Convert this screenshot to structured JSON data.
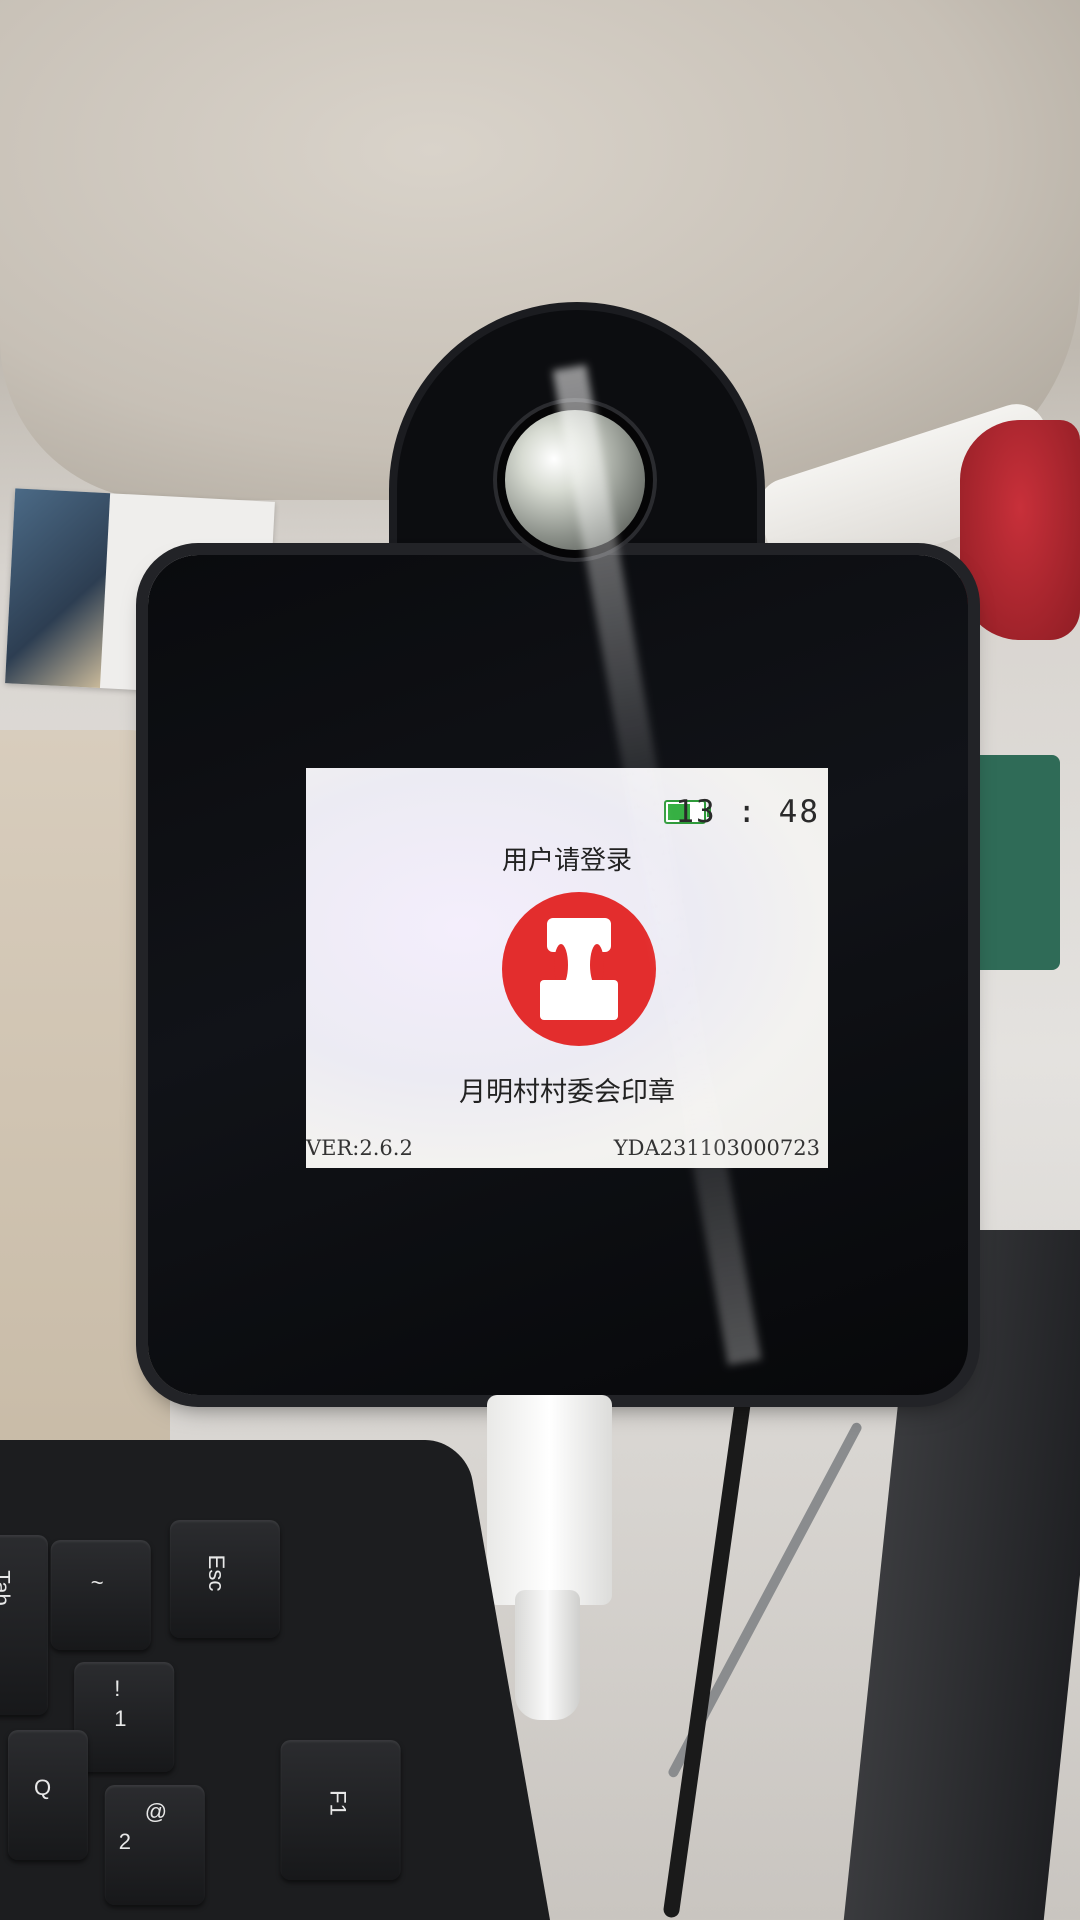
{
  "device_screen": {
    "time": "13 : 48",
    "battery_icon": "battery-full-icon",
    "login_prompt": "用户请登录",
    "seal_icon": "stamp-icon",
    "seal_name": "月明村村委会印章",
    "version": "VER:2.6.2",
    "serial": "YDA231103000723",
    "accent_color": "#e32d2d",
    "battery_color": "#36b043"
  },
  "keyboard": {
    "keys": {
      "esc": "Esc",
      "tab": "Tab",
      "tilde": "~",
      "one": "!",
      "one_digit": "1",
      "q": "Q",
      "at": "@",
      "two": "2",
      "f1": "F1"
    }
  }
}
